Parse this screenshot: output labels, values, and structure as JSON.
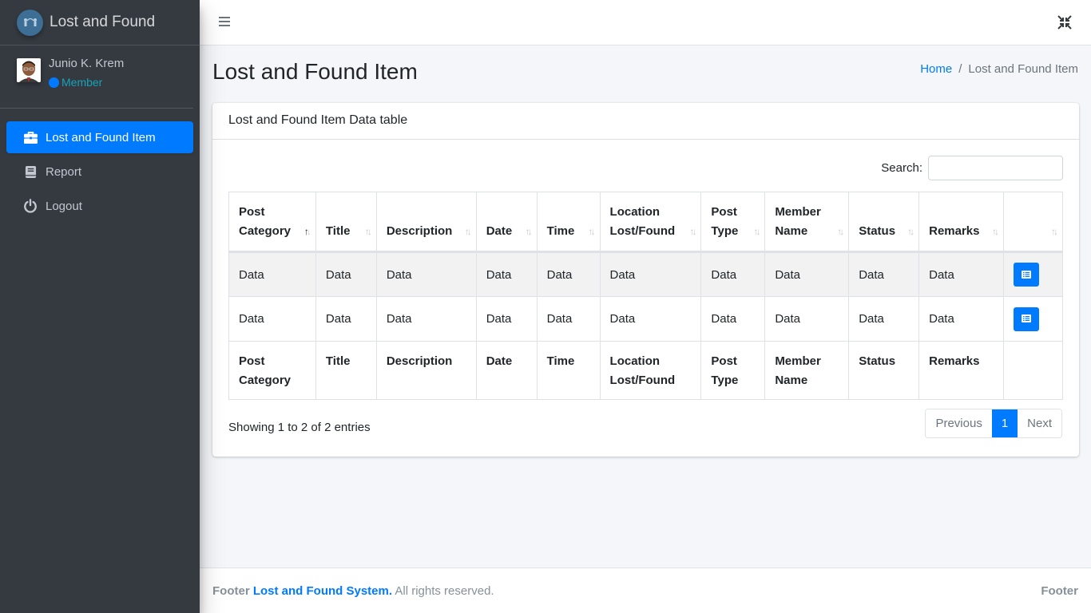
{
  "brand": {
    "name": "Lost and Found",
    "icon": "brand-logo-icon"
  },
  "user": {
    "name": "Junio K. Krem",
    "role": "Member",
    "role_color": "#007bff"
  },
  "sidebar": {
    "items": [
      {
        "label": "Lost and Found Item",
        "icon": "briefcase-icon",
        "active": true
      },
      {
        "label": "Report",
        "icon": "book-icon",
        "active": false
      },
      {
        "label": "Logout",
        "icon": "power-icon",
        "active": false
      }
    ]
  },
  "topbar": {
    "menu_icon": "hamburger-icon",
    "fullscreen_icon": "compress-icon"
  },
  "header": {
    "title": "Lost and Found Item",
    "breadcrumb": [
      {
        "label": "Home",
        "link": true
      },
      {
        "label": "Lost and Found Item",
        "link": false
      }
    ],
    "separator": "/"
  },
  "card": {
    "title": "Lost and Found Item Data table",
    "search": {
      "label": "Search:",
      "value": "",
      "placeholder": ""
    },
    "table": {
      "columns": [
        "Post Category",
        "Title",
        "Description",
        "Date",
        "Time",
        "Location Lost/Found",
        "Post Type",
        "Member Name",
        "Status",
        "Remarks",
        ""
      ],
      "sorted_column": "Post Category",
      "sort_direction": "asc",
      "rows": [
        [
          "Data",
          "Data",
          "Data",
          "Data",
          "Data",
          "Data",
          "Data",
          "Data",
          "Data",
          "Data"
        ],
        [
          "Data",
          "Data",
          "Data",
          "Data",
          "Data",
          "Data",
          "Data",
          "Data",
          "Data",
          "Data"
        ]
      ],
      "row_action_icon": "list-icon"
    },
    "info": "Showing 1 to 2 of 2 entries",
    "pagination": {
      "previous": "Previous",
      "pages": [
        "1"
      ],
      "current": "1",
      "next": "Next"
    }
  },
  "footer": {
    "prefix": "Footer",
    "system_name": "Lost and Found System.",
    "rights": "All rights reserved.",
    "right_text": "Footer"
  },
  "colors": {
    "primary": "#007bff",
    "sidebar_bg": "#343a40",
    "page_bg": "#f4f6f9"
  }
}
